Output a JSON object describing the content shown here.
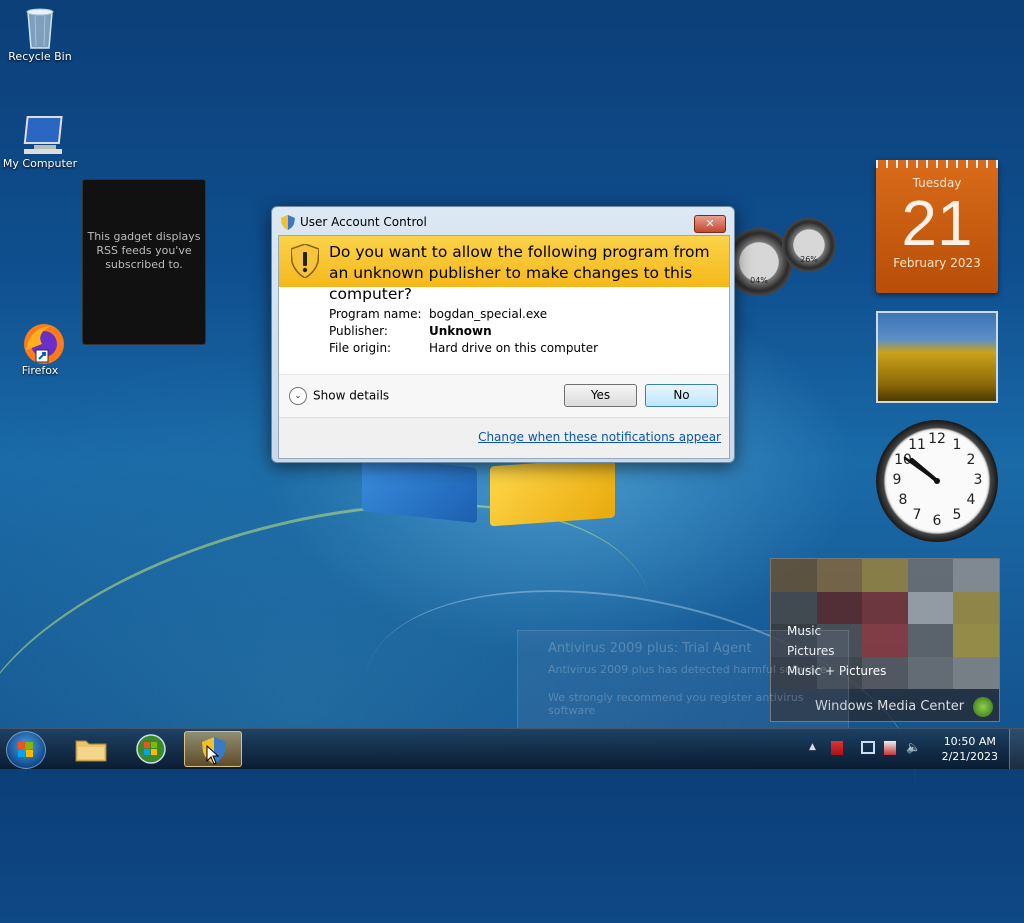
{
  "desktop": {
    "icons": [
      {
        "name": "recycle-bin-icon",
        "label": "Recycle Bin"
      },
      {
        "name": "my-computer-icon",
        "label": "My Computer"
      },
      {
        "name": "firefox-icon",
        "label": "Firefox"
      }
    ]
  },
  "gadgets": {
    "rss_text": "This gadget displays RSS feeds you've subscribed to.",
    "calendar": {
      "weekday": "Tuesday",
      "day": "21",
      "month_year": "February 2023"
    },
    "meters": {
      "cpu": "04%",
      "memory": "26%"
    },
    "clock_numbers": [
      "12",
      "1",
      "2",
      "3",
      "4",
      "5",
      "6",
      "7",
      "8",
      "9",
      "10",
      "11"
    ],
    "media_center": {
      "items": [
        "Music",
        "Pictures",
        "Music + Pictures"
      ],
      "title": "Windows Media Center"
    }
  },
  "notification": {
    "title": "Antivirus 2009 plus: Trial Agent",
    "line1": "Antivirus 2009 plus has detected harmful software",
    "line2": "We strongly recommend you register antivirus software"
  },
  "uac": {
    "window_title": "User Account Control",
    "question": "Do you want to allow the following program from an unknown publisher to make changes to this computer?",
    "program_name_label": "Program name:",
    "program_name_value": "bogdan_special.exe",
    "publisher_label": "Publisher:",
    "publisher_value": "Unknown",
    "origin_label": "File origin:",
    "origin_value": "Hard drive on this computer",
    "show_details": "Show details",
    "yes": "Yes",
    "no": "No",
    "change_link": "Change when these notifications appear",
    "close_glyph": "✕"
  },
  "taskbar": {
    "time": "10:50 AM",
    "date": "2/21/2023",
    "tray_arrow": "▲"
  },
  "colors": {
    "uac_banner": "#f5b81b",
    "link": "#0b54b0",
    "calendar": "#d96b1a"
  }
}
